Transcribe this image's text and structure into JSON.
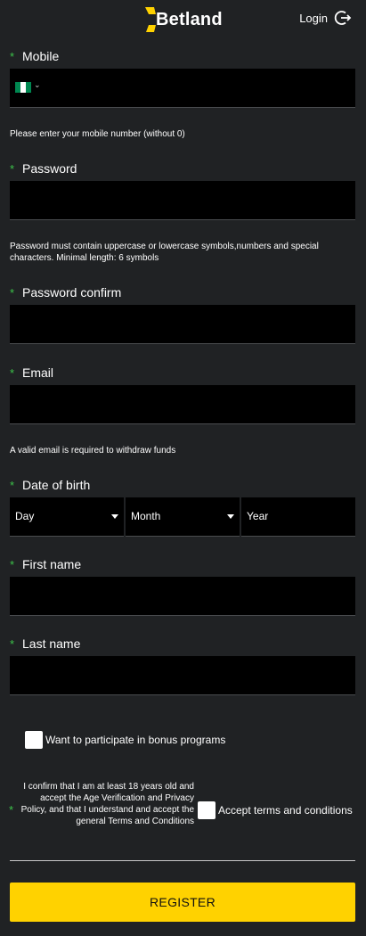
{
  "header": {
    "logo_text": "Betland",
    "login_label": "Login"
  },
  "form": {
    "mobile": {
      "label": "Mobile",
      "hint": "Please enter your mobile number (without 0)"
    },
    "password": {
      "label": "Password",
      "hint": "Password must contain uppercase or lowercase symbols,numbers and special characters. Minimal length: 6 symbols"
    },
    "password_confirm": {
      "label": "Password confirm"
    },
    "email": {
      "label": "Email",
      "hint": "A valid email is required to withdraw funds"
    },
    "dob": {
      "label": "Date of birth",
      "day": "Day",
      "month": "Month",
      "year": "Year"
    },
    "first_name": {
      "label": "First name"
    },
    "last_name": {
      "label": "Last name"
    },
    "required_mark": "*",
    "bonus_label": "Want to participate in bonus programs",
    "confirm_text": "I confirm that I am at least 18 years old and accept the Age Verification and Privacy Policy, and that I understand and accept the general Terms and Conditions",
    "terms_label": "Accept terms and conditions",
    "register_label": "REGISTER"
  },
  "colors": {
    "background": "#202224",
    "field": "#000000",
    "accent": "#ffd200",
    "required": "#3cc24a"
  },
  "icons": {
    "login": "logout-arrow-icon",
    "country_flag": "nigeria-flag-icon",
    "dropdown": "chevron-down-icon"
  }
}
